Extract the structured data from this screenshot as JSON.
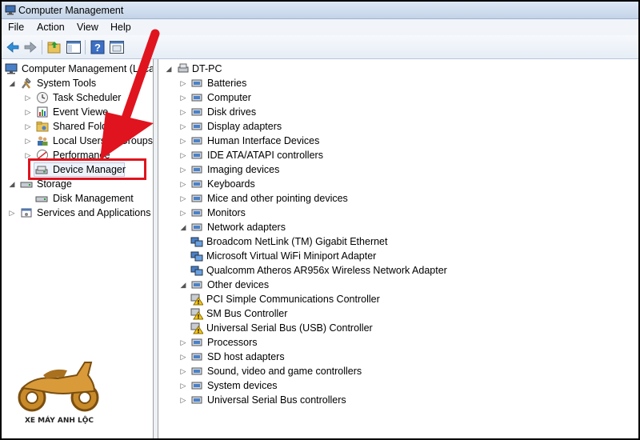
{
  "window": {
    "title": "Computer Management"
  },
  "menu": [
    "File",
    "Action",
    "View",
    "Help"
  ],
  "toolbar": {
    "buttons": [
      "back-icon",
      "forward-icon",
      "up-folder-icon",
      "show-hide-tree-icon",
      "help-icon",
      "properties-icon"
    ]
  },
  "left_tree": {
    "root": "Computer Management (Local",
    "system_tools": "System Tools",
    "task_scheduler": "Task Scheduler",
    "event_viewer": "Event Viewe",
    "shared_folders": "Shared Folde",
    "local_users": "Local Users a",
    "local_users_suffix": "Groups",
    "performance": "Performance",
    "device_manager": "Device Manager",
    "storage": "Storage",
    "disk_management": "Disk Management",
    "services": "Services and Applications"
  },
  "right_tree": {
    "root": "DT-PC",
    "categories": [
      "Batteries",
      "Computer",
      "Disk drives",
      "Display adapters",
      "Human Interface Devices",
      "IDE ATA/ATAPI controllers",
      "Imaging devices",
      "Keyboards",
      "Mice and other pointing devices",
      "Monitors",
      "Network adapters",
      "Broadcom NetLink (TM) Gigabit Ethernet",
      "Microsoft Virtual WiFi Miniport Adapter",
      "Qualcomm Atheros AR956x Wireless Network Adapter",
      "Other devices",
      "PCI Simple Communications Controller",
      "SM Bus Controller",
      "Universal Serial Bus (USB) Controller",
      "Processors",
      "SD host adapters",
      "Sound, video and game controllers",
      "System devices",
      "Universal Serial Bus controllers"
    ]
  },
  "watermark": {
    "text": "XE MÁY ANH LỘC"
  },
  "colors": {
    "highlight": "#e0141e",
    "arrow": "#e0141e",
    "titlebar": "#c3d3e8"
  }
}
